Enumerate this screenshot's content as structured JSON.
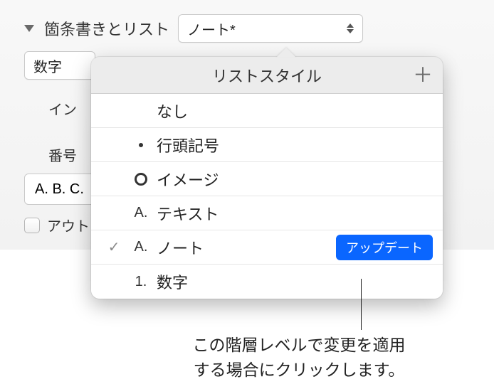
{
  "section": {
    "title": "箇条書きとリスト",
    "style_select": "ノート*",
    "type_select": "数字",
    "indent_label_cut": "イン",
    "number_label_cut": "番号",
    "format_example": "A. B. C.",
    "outline_label_cut": "アウト"
  },
  "popover": {
    "title": "リストスタイル",
    "items": [
      {
        "marker": "",
        "label": "なし",
        "selected": false
      },
      {
        "marker": "bullet",
        "label": "行頭記号",
        "selected": false
      },
      {
        "marker": "circle",
        "label": "イメージ",
        "selected": false
      },
      {
        "marker_text": "A.",
        "label": "テキスト",
        "selected": false
      },
      {
        "marker_text": "A.",
        "label": "ノート",
        "selected": true,
        "update": true
      },
      {
        "marker_text": "1.",
        "label": "数字",
        "selected": false
      }
    ],
    "update_label": "アップデート"
  },
  "callout": "この階層レベルで変更を適用\nする場合にクリックします。"
}
